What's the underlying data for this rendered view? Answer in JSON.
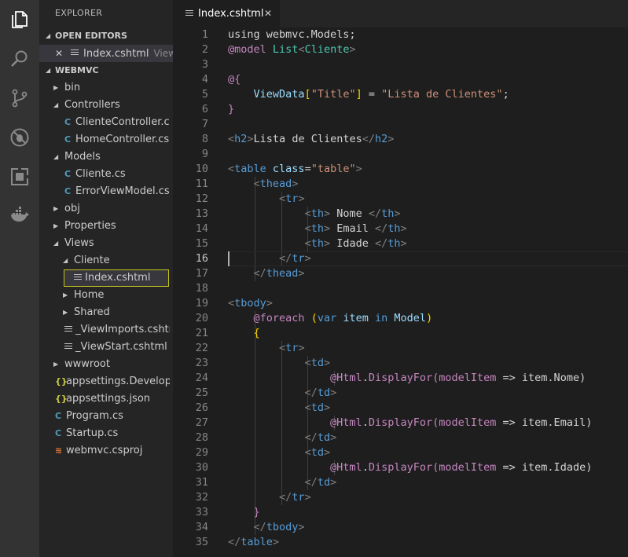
{
  "sidebar": {
    "title": "EXPLORER",
    "open_editors_label": "OPEN EDITORS",
    "open_editor": {
      "close": "✕",
      "name": "Index.cshtml",
      "hint": "Views\\Cliente"
    },
    "project_label": "WEBMVC",
    "tree": [
      {
        "label": "bin",
        "kind": "folder-closed",
        "depth": 0
      },
      {
        "label": "Controllers",
        "kind": "folder-open",
        "depth": 0
      },
      {
        "label": "ClienteController.cs",
        "kind": "cs",
        "depth": 1
      },
      {
        "label": "HomeController.cs",
        "kind": "cs",
        "depth": 1
      },
      {
        "label": "Models",
        "kind": "folder-open",
        "depth": 0
      },
      {
        "label": "Cliente.cs",
        "kind": "cs",
        "depth": 1
      },
      {
        "label": "ErrorViewModel.cs",
        "kind": "cs",
        "depth": 1
      },
      {
        "label": "obj",
        "kind": "folder-closed",
        "depth": 0
      },
      {
        "label": "Properties",
        "kind": "folder-closed",
        "depth": 0
      },
      {
        "label": "Views",
        "kind": "folder-open",
        "depth": 0
      },
      {
        "label": "Cliente",
        "kind": "folder-open",
        "depth": 1
      },
      {
        "label": "Index.cshtml",
        "kind": "file-selected",
        "depth": 2
      },
      {
        "label": "Home",
        "kind": "folder-closed",
        "depth": 1
      },
      {
        "label": "Shared",
        "kind": "folder-closed",
        "depth": 1
      },
      {
        "label": "_ViewImports.cshtml",
        "kind": "file",
        "depth": 1
      },
      {
        "label": "_ViewStart.cshtml",
        "kind": "file",
        "depth": 1
      },
      {
        "label": "wwwroot",
        "kind": "folder-closed",
        "depth": 0
      },
      {
        "label": "appsettings.Development.json",
        "kind": "json",
        "depth": 0
      },
      {
        "label": "appsettings.json",
        "kind": "json",
        "depth": 0
      },
      {
        "label": "Program.cs",
        "kind": "cs",
        "depth": 0
      },
      {
        "label": "Startup.cs",
        "kind": "cs",
        "depth": 0
      },
      {
        "label": "webmvc.csproj",
        "kind": "rss",
        "depth": 0
      }
    ]
  },
  "tab": {
    "name": "Index.cshtml",
    "close": "✕"
  },
  "editor": {
    "active_line": 16,
    "lines": [
      [
        [
          "txt",
          "using webmvc.Models;"
        ]
      ],
      [
        [
          "razor",
          "@model"
        ],
        [
          "txt",
          " "
        ],
        [
          "type",
          "List"
        ],
        [
          "br",
          "<"
        ],
        [
          "type",
          "Cliente"
        ],
        [
          "br",
          ">"
        ]
      ],
      [],
      [
        [
          "razor",
          "@{"
        ]
      ],
      [
        [
          "txt",
          "    "
        ],
        [
          "var",
          "ViewData"
        ],
        [
          "gold",
          "["
        ],
        [
          "str",
          "\"Title\""
        ],
        [
          "gold",
          "]"
        ],
        [
          "txt",
          " = "
        ],
        [
          "str",
          "\"Lista de Clientes\""
        ],
        [
          "txt",
          ";"
        ]
      ],
      [
        [
          "razor",
          "}"
        ]
      ],
      [],
      [
        [
          "br",
          "<"
        ],
        [
          "tag",
          "h2"
        ],
        [
          "br",
          ">"
        ],
        [
          "txt",
          "Lista de Clientes"
        ],
        [
          "br",
          "</"
        ],
        [
          "tag",
          "h2"
        ],
        [
          "br",
          ">"
        ]
      ],
      [],
      [
        [
          "br",
          "<"
        ],
        [
          "tag",
          "table"
        ],
        [
          "txt",
          " "
        ],
        [
          "attr",
          "class"
        ],
        [
          "txt",
          "="
        ],
        [
          "str",
          "\"table\""
        ],
        [
          "br",
          ">"
        ]
      ],
      [
        [
          "txt",
          "    "
        ],
        [
          "br",
          "<"
        ],
        [
          "tag",
          "thead"
        ],
        [
          "br",
          ">"
        ]
      ],
      [
        [
          "txt",
          "        "
        ],
        [
          "br",
          "<"
        ],
        [
          "tag",
          "tr"
        ],
        [
          "br",
          ">"
        ]
      ],
      [
        [
          "txt",
          "            "
        ],
        [
          "br",
          "<"
        ],
        [
          "tag",
          "th"
        ],
        [
          "br",
          ">"
        ],
        [
          "txt",
          " Nome "
        ],
        [
          "br",
          "</"
        ],
        [
          "tag",
          "th"
        ],
        [
          "br",
          ">"
        ]
      ],
      [
        [
          "txt",
          "            "
        ],
        [
          "br",
          "<"
        ],
        [
          "tag",
          "th"
        ],
        [
          "br",
          ">"
        ],
        [
          "txt",
          " Email "
        ],
        [
          "br",
          "</"
        ],
        [
          "tag",
          "th"
        ],
        [
          "br",
          ">"
        ]
      ],
      [
        [
          "txt",
          "            "
        ],
        [
          "br",
          "<"
        ],
        [
          "tag",
          "th"
        ],
        [
          "br",
          ">"
        ],
        [
          "txt",
          " Idade "
        ],
        [
          "br",
          "</"
        ],
        [
          "tag",
          "th"
        ],
        [
          "br",
          ">"
        ]
      ],
      [
        [
          "txt",
          "        "
        ],
        [
          "br",
          "</"
        ],
        [
          "tag",
          "tr"
        ],
        [
          "br",
          ">"
        ]
      ],
      [
        [
          "txt",
          "    "
        ],
        [
          "br",
          "</"
        ],
        [
          "tag",
          "thead"
        ],
        [
          "br",
          ">"
        ]
      ],
      [],
      [
        [
          "br",
          "<"
        ],
        [
          "tag",
          "tbody"
        ],
        [
          "br",
          ">"
        ]
      ],
      [
        [
          "txt",
          "    "
        ],
        [
          "razor",
          "@foreach"
        ],
        [
          "txt",
          " "
        ],
        [
          "gold",
          "("
        ],
        [
          "kw",
          "var"
        ],
        [
          "txt",
          " "
        ],
        [
          "var",
          "item"
        ],
        [
          "txt",
          " "
        ],
        [
          "kw",
          "in"
        ],
        [
          "txt",
          " "
        ],
        [
          "var",
          "Model"
        ],
        [
          "gold",
          ")"
        ]
      ],
      [
        [
          "txt",
          "    "
        ],
        [
          "gold",
          "{"
        ]
      ],
      [
        [
          "txt",
          "        "
        ],
        [
          "br",
          "<"
        ],
        [
          "tag",
          "tr"
        ],
        [
          "br",
          ">"
        ]
      ],
      [
        [
          "txt",
          "            "
        ],
        [
          "br",
          "<"
        ],
        [
          "tag",
          "td"
        ],
        [
          "br",
          ">"
        ]
      ],
      [
        [
          "txt",
          "                "
        ],
        [
          "razor",
          "@Html"
        ],
        [
          "txt",
          "."
        ],
        [
          "razor",
          "DisplayFor"
        ],
        [
          "razor",
          "("
        ],
        [
          "razor",
          "modelItem"
        ],
        [
          "txt",
          " => "
        ],
        [
          "txt",
          "item.Nome)"
        ]
      ],
      [
        [
          "txt",
          "            "
        ],
        [
          "br",
          "</"
        ],
        [
          "tag",
          "td"
        ],
        [
          "br",
          ">"
        ]
      ],
      [
        [
          "txt",
          "            "
        ],
        [
          "br",
          "<"
        ],
        [
          "tag",
          "td"
        ],
        [
          "br",
          ">"
        ]
      ],
      [
        [
          "txt",
          "                "
        ],
        [
          "razor",
          "@Html"
        ],
        [
          "txt",
          "."
        ],
        [
          "razor",
          "DisplayFor"
        ],
        [
          "razor",
          "("
        ],
        [
          "razor",
          "modelItem"
        ],
        [
          "txt",
          " => "
        ],
        [
          "txt",
          "item.Email)"
        ]
      ],
      [
        [
          "txt",
          "            "
        ],
        [
          "br",
          "</"
        ],
        [
          "tag",
          "td"
        ],
        [
          "br",
          ">"
        ]
      ],
      [
        [
          "txt",
          "            "
        ],
        [
          "br",
          "<"
        ],
        [
          "tag",
          "td"
        ],
        [
          "br",
          ">"
        ]
      ],
      [
        [
          "txt",
          "                "
        ],
        [
          "razor",
          "@Html"
        ],
        [
          "txt",
          "."
        ],
        [
          "razor",
          "DisplayFor"
        ],
        [
          "razor",
          "("
        ],
        [
          "razor",
          "modelItem"
        ],
        [
          "txt",
          " => "
        ],
        [
          "txt",
          "item.Idade)"
        ]
      ],
      [
        [
          "txt",
          "            "
        ],
        [
          "br",
          "</"
        ],
        [
          "tag",
          "td"
        ],
        [
          "br",
          ">"
        ]
      ],
      [
        [
          "txt",
          "        "
        ],
        [
          "br",
          "</"
        ],
        [
          "tag",
          "tr"
        ],
        [
          "br",
          ">"
        ]
      ],
      [
        [
          "txt",
          "    "
        ],
        [
          "razor",
          "}"
        ]
      ],
      [
        [
          "txt",
          "    "
        ],
        [
          "br",
          "</"
        ],
        [
          "tag",
          "tbody"
        ],
        [
          "br",
          ">"
        ]
      ],
      [
        [
          "br",
          "</"
        ],
        [
          "tag",
          "table"
        ],
        [
          "br",
          ">"
        ]
      ]
    ]
  }
}
